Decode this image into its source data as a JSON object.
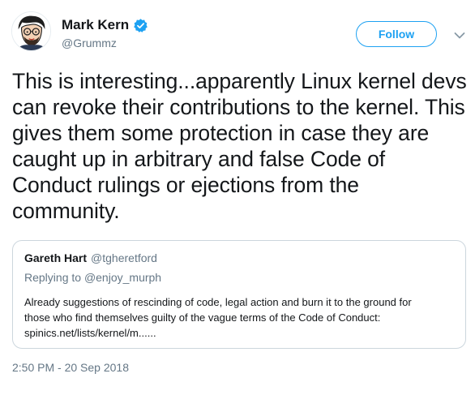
{
  "author": {
    "name": "Mark Kern",
    "handle": "@Grummz",
    "verified": true,
    "avatar_icon": "cartoon-face-avatar"
  },
  "follow_button": {
    "label": "Follow"
  },
  "menu": {
    "icon": "chevron-down-icon"
  },
  "tweet": {
    "text": "This is interesting...apparently Linux kernel devs can revoke their contributions to the kernel. This gives them some protection in case they are caught up in arbitrary and false Code of Conduct rulings or ejections from the community."
  },
  "quoted_tweet": {
    "author_name": "Gareth Hart",
    "author_handle": "@tgheretford",
    "replying_prefix": "Replying to",
    "replying_to": "@enjoy_murph",
    "body_lines": [
      "Already suggestions of rescinding of code, legal action and burn it to the ground for",
      "those who find themselves guilty of the vague terms of the Code of Conduct:",
      "spinics.net/lists/kernel/m......"
    ]
  },
  "timestamp": "2:50 PM - 20 Sep 2018",
  "colors": {
    "accent": "#1da1f2",
    "text": "#14171a",
    "muted": "#657786",
    "border": "#ccd6dd"
  }
}
